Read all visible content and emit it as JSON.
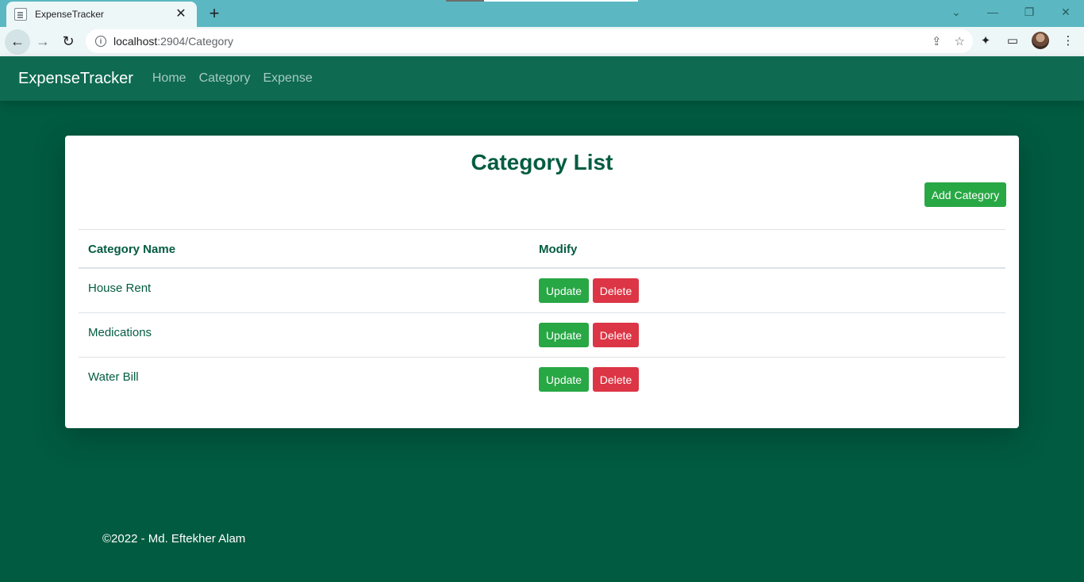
{
  "browser": {
    "tab_title": "ExpenseTracker",
    "url_host": "localhost",
    "url_path": ":2904/Category"
  },
  "navbar": {
    "brand": "ExpenseTracker",
    "links": [
      "Home",
      "Category",
      "Expense"
    ]
  },
  "page": {
    "title": "Category List",
    "add_button": "Add Category",
    "columns": [
      "Category Name",
      "Modify"
    ],
    "rows": [
      {
        "name": "House Rent",
        "update": "Update",
        "delete": "Delete"
      },
      {
        "name": "Medications",
        "update": "Update",
        "delete": "Delete"
      },
      {
        "name": "Water Bill",
        "update": "Update",
        "delete": "Delete"
      }
    ]
  },
  "footer": {
    "text": "©2022 - Md. Eftekher Alam"
  },
  "colors": {
    "page_bg": "#015b40",
    "navbar_bg": "#0e6a51",
    "success": "#28a745",
    "danger": "#dc3545",
    "heading": "#045c41"
  }
}
